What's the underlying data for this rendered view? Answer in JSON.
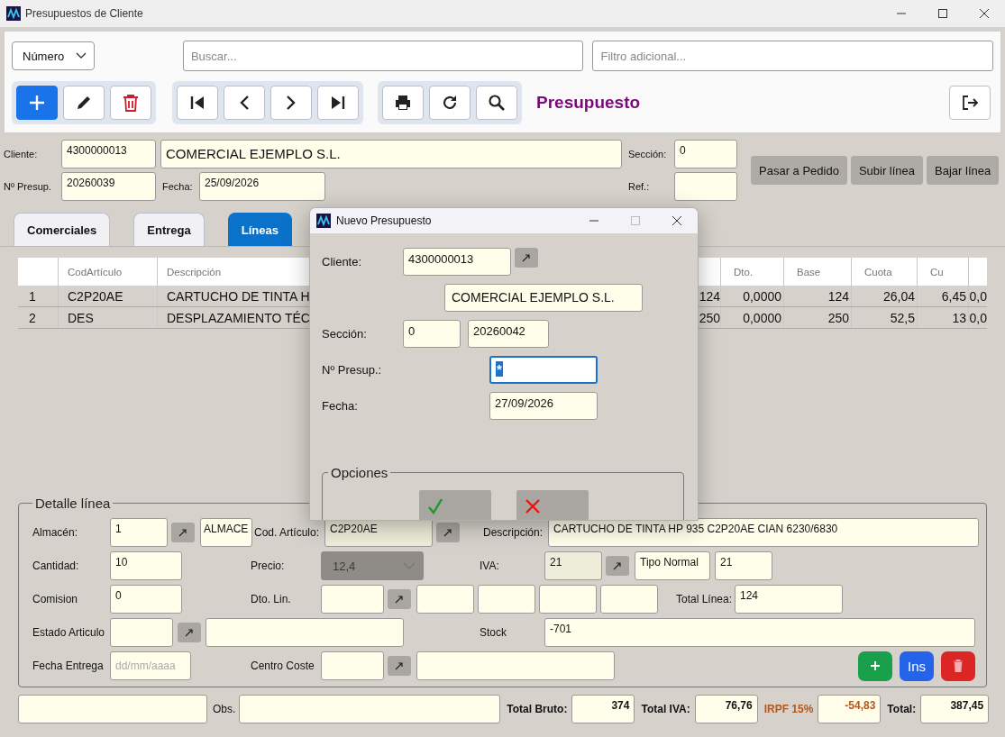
{
  "window": {
    "title": "Presupuestos de Cliente"
  },
  "toolbar": {
    "sort_select": {
      "value": "Número"
    },
    "search": {
      "placeholder": "Buscar..."
    },
    "filter": {
      "placeholder": "Filtro adicional..."
    },
    "groups": [
      {
        "buttons": [
          {
            "kind": "new"
          },
          {
            "kind": "edit"
          },
          {
            "kind": "delete"
          }
        ]
      },
      {
        "buttons": [
          {
            "kind": "first"
          },
          {
            "kind": "previous"
          },
          {
            "kind": "next"
          },
          {
            "kind": "last"
          }
        ]
      },
      {
        "buttons": [
          {
            "kind": "print"
          },
          {
            "kind": "refresh"
          },
          {
            "kind": "search"
          }
        ]
      }
    ],
    "heading": "Presupuesto"
  },
  "header": {
    "cliente": {
      "label": "Cliente:",
      "code": "4300000013",
      "name": "COMERCIAL EJEMPLO S.L."
    },
    "seccion": {
      "label": "Sección:",
      "value": "0"
    },
    "presupuesto": {
      "label": "Nº Presup.",
      "value": "20260039"
    },
    "fecha": {
      "label": "Fecha:",
      "value": "25/09/2026"
    },
    "ref": {
      "label": "Ref.:"
    },
    "actions": [
      "Pasar a Pedido",
      "Subir línea",
      "Bajar línea"
    ]
  },
  "tabs": [
    {
      "label": "Comerciales",
      "selected": false
    },
    {
      "label": "Entrega",
      "selected": false
    },
    {
      "label": "Líneas",
      "selected": true
    }
  ],
  "table": {
    "columns": [
      {
        "kind": "index"
      },
      {
        "kind": "text",
        "label": "CodArtículo"
      },
      {
        "kind": "text",
        "label": "Descripción"
      },
      {
        "kind": "gap"
      },
      {
        "kind": "number"
      },
      {
        "kind": "number",
        "label": "Dto."
      },
      {
        "kind": "number",
        "label": "Base"
      },
      {
        "kind": "number",
        "label": "Cuota"
      },
      {
        "kind": "number",
        "label": "Cu"
      },
      {
        "kind": "number"
      }
    ],
    "rows": [
      {
        "cells": [
          "1",
          "C2P20AE",
          "CARTUCHO DE TINTA H",
          "",
          "124",
          "0,0000",
          "124",
          "26,04",
          "6,45",
          "0,0"
        ]
      },
      {
        "cells": [
          "2",
          "DES",
          "DESPLAZAMIENTO TÉC",
          "",
          "250",
          "0,0000",
          "250",
          "52,5",
          "13",
          "0,0"
        ]
      }
    ]
  },
  "detail": {
    "legend": "Detalle línea",
    "almacen": {
      "label": "Almacén:",
      "code": "1",
      "name": "ALMACE"
    },
    "articulo": {
      "label": "Cod. Artículo:",
      "code": "C2P20AE"
    },
    "descripcion": {
      "label": "Descripción:",
      "value": "CARTUCHO DE TINTA HP 935 C2P20AE CIAN 6230/6830"
    },
    "cantidad": {
      "label": "Cantidad:",
      "value": "10"
    },
    "precio": {
      "label": "Precio:",
      "value": "12,4",
      "disabled": true
    },
    "iva": {
      "label": "IVA:",
      "code": "21",
      "type": "Tipo Normal",
      "rate": "21"
    },
    "comision": {
      "label": "Comision",
      "value": "0"
    },
    "dto_lin": {
      "label": "Dto. Lin."
    },
    "total_linea": {
      "label": "Total Línea:",
      "value": "124"
    },
    "estado": {
      "label": "Estado Articulo"
    },
    "stock": {
      "label": "Stock",
      "value": "-701"
    },
    "fecha_entrega": {
      "label": "Fecha Entrega",
      "placeholder": "dd/mm/aaaa"
    },
    "centro_coste": {
      "label": "Centro Coste"
    },
    "buttons": [
      {
        "kind": "add"
      },
      {
        "kind": "insert",
        "label": "Ins"
      },
      {
        "kind": "delete"
      }
    ]
  },
  "totals": {
    "obs_label": "Obs.",
    "items": [
      {
        "kind": "normal",
        "label": "Total Bruto:",
        "value": "374"
      },
      {
        "kind": "normal",
        "label": "Total IVA:",
        "value": "76,76"
      },
      {
        "kind": "withholding",
        "label": "IRPF 15%",
        "value": "-54,83"
      },
      {
        "kind": "normal",
        "label": "Total:",
        "value": "387,45"
      }
    ]
  },
  "dialog": {
    "title": "Nuevo Presupuesto",
    "cliente": {
      "label": "Cliente:",
      "code": "4300000013",
      "name": "COMERCIAL EJEMPLO S.L."
    },
    "seccion": {
      "label": "Sección:",
      "value": "0",
      "number": "20260042"
    },
    "presupuesto": {
      "label": "Nº Presup.:",
      "value": "*",
      "focused": true
    },
    "fecha": {
      "label": "Fecha:",
      "value": "27/09/2026"
    },
    "options_legend": "Opciones",
    "buttons": [
      {
        "kind": "accept"
      },
      {
        "kind": "cancel"
      }
    ]
  }
}
